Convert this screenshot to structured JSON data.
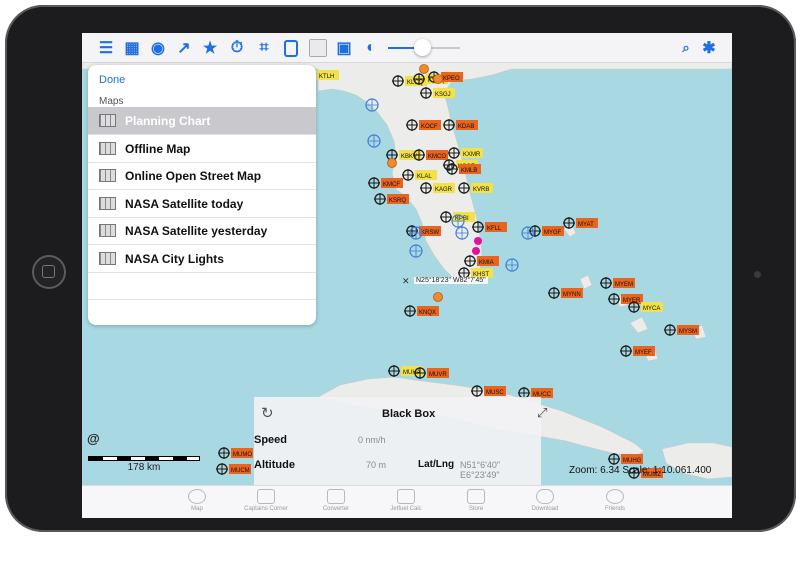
{
  "toolbar": {
    "tools": [
      "equalizer-icon",
      "map-icon",
      "globe-icon",
      "route-icon",
      "star-icon",
      "timer-icon",
      "crop-icon",
      "tablet-icon",
      "layer-box-icon",
      "bus-icon",
      "palette-icon"
    ],
    "brightness_fraction": 0.47,
    "right_icons": [
      "search-icon",
      "bug-icon"
    ]
  },
  "maps_panel": {
    "done_label": "Done",
    "section_header": "Maps",
    "items": [
      {
        "label": "Planning Chart",
        "selected": true
      },
      {
        "label": "Offline Map",
        "selected": false
      },
      {
        "label": "Online Open Street Map",
        "selected": false
      },
      {
        "label": "NASA Satellite today",
        "selected": false
      },
      {
        "label": "NASA Satellite yesterday",
        "selected": false
      },
      {
        "label": "NASA City Lights",
        "selected": false
      }
    ]
  },
  "map": {
    "cursor_coords": "N25°18'23\"  W82°7'45\"",
    "airport_labels": [
      "KTLH",
      "KLCQ",
      "KVQQ",
      "KSGJ",
      "KPEO",
      "KDAB",
      "KOCF",
      "KBKV",
      "KMCO",
      "KXMR",
      "KCOF",
      "KMLB",
      "KLAL",
      "KMCF",
      "KAGR",
      "KVRB",
      "KSRQ",
      "KPBI",
      "KFLL",
      "KRSW",
      "KMIA",
      "KHST",
      "MYGF",
      "MYAT",
      "MYEM",
      "MYNN",
      "MYER",
      "MYCA",
      "MYSM",
      "MYEF",
      "KNQX",
      "MUHA",
      "MUVR",
      "MUSC",
      "MUCC",
      "MUMO",
      "MUHG",
      "MUMZ",
      "MUCM"
    ],
    "accent_orange": "#e8641f",
    "label_yellow": "#f3e14b",
    "land_color": "#ececea",
    "water_color": "#a8d8e2",
    "waypoint_pink": "#e0149a"
  },
  "at_sign": "@",
  "scale_bar": {
    "label": "178 km"
  },
  "black_box": {
    "title": "Black Box",
    "speed_label": "Speed",
    "speed_value": "0 nm/h",
    "altitude_label": "Altitude",
    "altitude_value": "70 m",
    "latlng_label": "Lat/Lng",
    "latlng_value": "N51°6'40\"   E6°23'49\""
  },
  "zoom_status": "Zoom: 6.34   Scale: 1:10.061.400",
  "tabbar": {
    "items": [
      {
        "label": "Map",
        "icon": "globe-icon"
      },
      {
        "label": "Captains Corner",
        "icon": "cap-icon"
      },
      {
        "label": "Converter",
        "icon": "calculator-icon"
      },
      {
        "label": "Jetfuel Calc",
        "icon": "fuel-icon"
      },
      {
        "label": "Store",
        "icon": "cart-icon"
      },
      {
        "label": "Download",
        "icon": "cloud-download-icon"
      },
      {
        "label": "Friends",
        "icon": "friends-icon"
      }
    ]
  }
}
